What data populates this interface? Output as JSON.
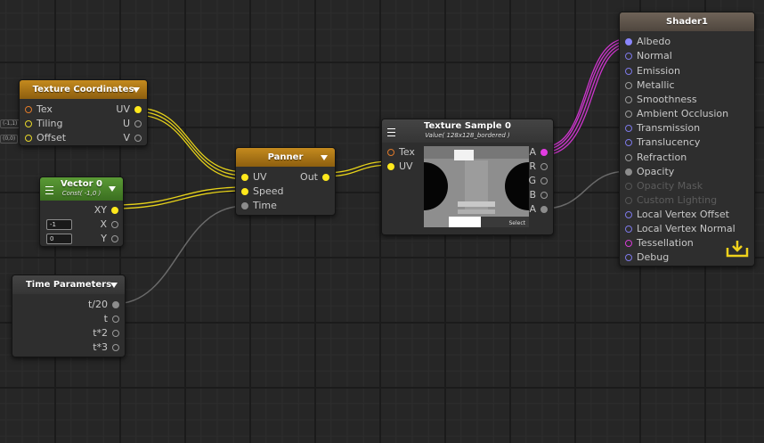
{
  "nodes": {
    "texcoords": {
      "title": "Texture Coordinates",
      "in": [
        "Tex",
        "Tiling",
        "Offset"
      ],
      "out": [
        "UV",
        "U",
        "V"
      ]
    },
    "vector0": {
      "title": "Vector 0",
      "subtitle": "Const( -1,0 )",
      "out": [
        "XY",
        "X",
        "Y"
      ],
      "x_value": "-1",
      "y_value": "0"
    },
    "time": {
      "title": "Time Parameters",
      "out": [
        "t/20",
        "t",
        "t*2",
        "t*3"
      ]
    },
    "panner": {
      "title": "Panner",
      "in": [
        "UV",
        "Speed",
        "Time"
      ],
      "out": [
        "Out"
      ]
    },
    "texsample": {
      "title": "Texture Sample 0",
      "subtitle": "Value( 128x128_bordered )",
      "in": [
        "Tex",
        "UV"
      ],
      "out": [
        "RGBA",
        "R",
        "G",
        "B",
        "A"
      ],
      "select_label": "Select"
    },
    "shader": {
      "title": "Shader1",
      "inputs": [
        "Albedo",
        "Normal",
        "Emission",
        "Metallic",
        "Smoothness",
        "Ambient Occlusion",
        "Transmission",
        "Translucency",
        "Refraction",
        "Opacity",
        "Opacity Mask",
        "Custom Lighting",
        "Local Vertex Offset",
        "Local Vertex Normal",
        "Tessellation",
        "Debug"
      ]
    }
  },
  "side_tags": [
    "(-1,1)",
    "(0,0)"
  ],
  "colors": {
    "float": "#9a9a9a",
    "vector2": "#ffe81c",
    "vector4": "#e23ce2",
    "vector3": "#8a86ff",
    "sampler": "#e07a2a",
    "header_orange": "#b07a18",
    "header_green": "#4f8a2c"
  },
  "icons": {
    "header_dropdown": "triangle-down",
    "node_menu": "hamburger",
    "master_output": "download-tray"
  }
}
